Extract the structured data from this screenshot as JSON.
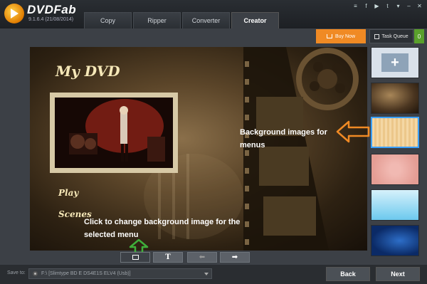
{
  "app": {
    "brand": "DVDFab",
    "version": "9.1.6.4 (21/08/2014)"
  },
  "tabs": [
    {
      "label": "Copy",
      "active": false
    },
    {
      "label": "Ripper",
      "active": false
    },
    {
      "label": "Converter",
      "active": false
    },
    {
      "label": "Creator",
      "active": true
    }
  ],
  "toolbar": {
    "buy_now": "Buy Now",
    "task_queue": "Task Queue",
    "task_count": "0"
  },
  "menu_preview": {
    "title": "My DVD",
    "play": "Play",
    "scenes": "Scenes"
  },
  "annotations": {
    "background_images": "Background images for menus",
    "change_background": "Click to change background image for the selected menu"
  },
  "bottom_tools": {
    "text_tool": "T",
    "prev_arrow": "⬅",
    "next_arrow": "➡"
  },
  "status": {
    "save_to_label": "Save to:",
    "save_to_value": "F:\\ [Slimtype BD  E  DS4E1S ELV4 (Usb)]"
  },
  "buttons": {
    "back": "Back",
    "next": "Next"
  },
  "colors": {
    "accent_orange": "#f08a24",
    "selection_blue": "#3aa0ff",
    "arrow_green": "#3fae3a",
    "task_green": "#5aa02c"
  }
}
